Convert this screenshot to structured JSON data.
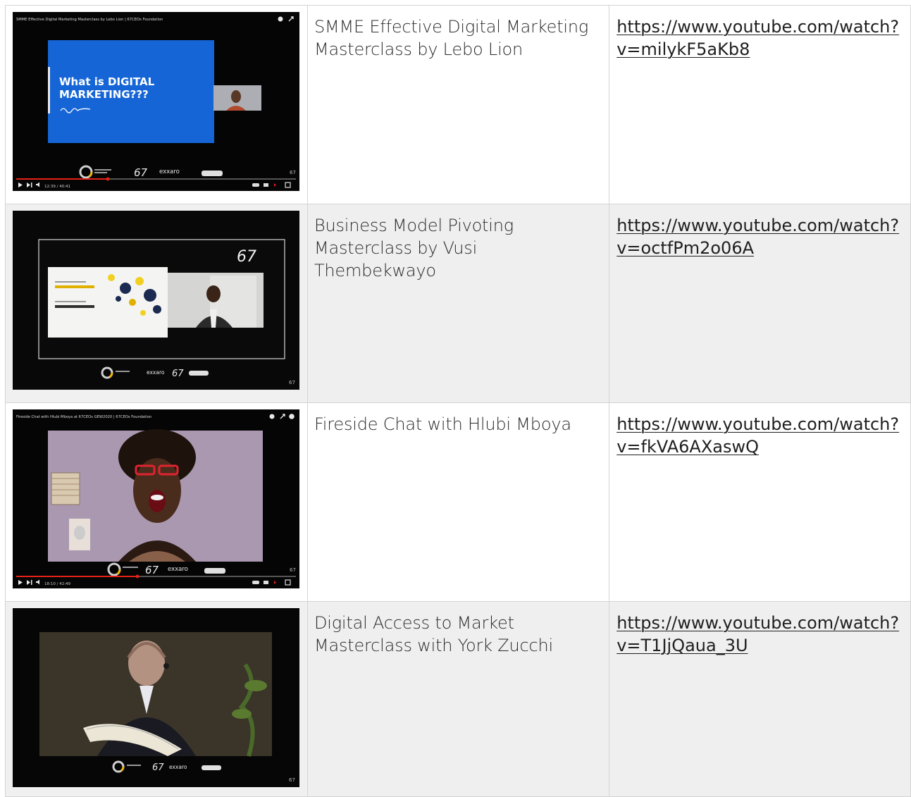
{
  "rows": [
    {
      "thumbnail": {
        "video_title_overlay": "SMME Effective Digital Marketing Masterclass by Lebo Lion | 67CEOs Foundation",
        "slide_text_line1": "What is DIGITAL",
        "slide_text_line2": "MARKETING???",
        "time": "12:39 / 40:41",
        "logo_text": "exxaro"
      },
      "title": "SMME Effective Digital Marketing Masterclass by Lebo Lion",
      "url": "https://www.youtube.com/watch?v=milykF5aKb8"
    },
    {
      "thumbnail": {
        "logo_text": "exxaro"
      },
      "title": "Business Model Pivoting Masterclass by Vusi Thembekwayo",
      "url": "https://www.youtube.com/watch?v=octfPm2o06A"
    },
    {
      "thumbnail": {
        "video_title_overlay": "Fireside Chat with Hlubi Mboya at 67CEOs GEW2020 | 67CEOs Foundation",
        "time": "18:10 / 42:49",
        "logo_text": "exxaro"
      },
      "title": "Fireside Chat with Hlubi Mboya",
      "url": "https://www.youtube.com/watch?v=fkVA6AXaswQ"
    },
    {
      "thumbnail": {
        "logo_text": "exxaro"
      },
      "title": "Digital Access to Market Masterclass with York Zucchi",
      "url": "https://www.youtube.com/watch?v=T1JjQaua_3U"
    }
  ]
}
